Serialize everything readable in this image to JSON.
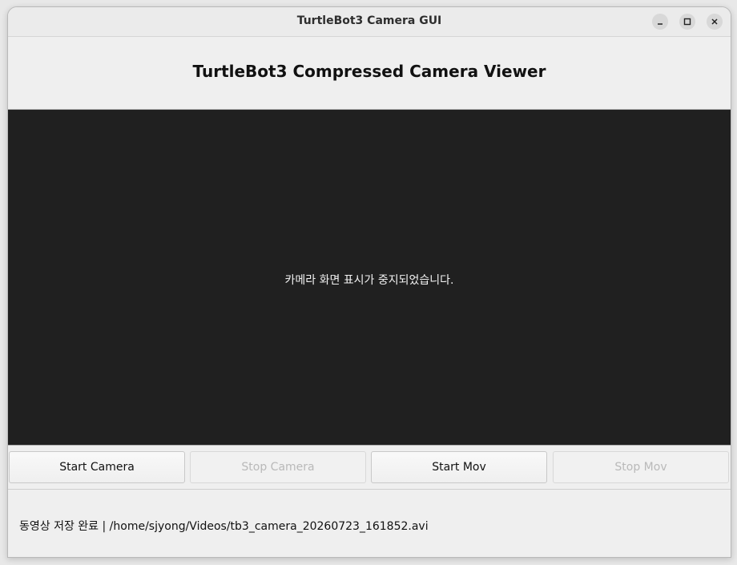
{
  "window": {
    "title": "TurtleBot3 Camera GUI"
  },
  "header": {
    "title": "TurtleBot3 Compressed Camera Viewer"
  },
  "viewer": {
    "message": "카메라 화면 표시가 중지되었습니다."
  },
  "controls": {
    "start_camera": "Start Camera",
    "stop_camera": "Stop Camera",
    "start_mov": "Start Mov",
    "stop_mov": "Stop Mov"
  },
  "status": {
    "text": "동영상 저장 완료 | /home/sjyong/Videos/tb3_camera_20260723_161852.avi"
  },
  "icons": {
    "minimize": "minimize-icon",
    "maximize": "maximize-icon",
    "close": "close-icon"
  }
}
